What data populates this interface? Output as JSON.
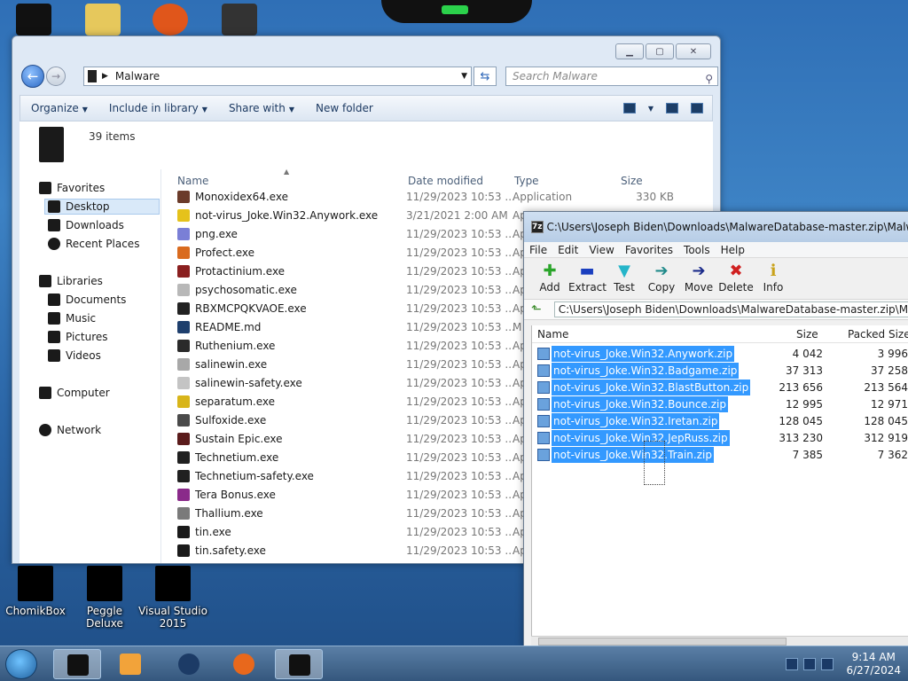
{
  "explorer": {
    "address": "Malware",
    "search_placeholder": "Search Malware",
    "toolbar": {
      "organize": "Organize",
      "include_in_library": "Include in library",
      "share_with": "Share with",
      "new_folder": "New folder"
    },
    "items_count": "39 items",
    "nav": {
      "favorites": "Favorites",
      "desktop": "Desktop",
      "downloads": "Downloads",
      "recent_places": "Recent Places",
      "libraries": "Libraries",
      "documents": "Documents",
      "music": "Music",
      "pictures": "Pictures",
      "videos": "Videos",
      "computer": "Computer",
      "network": "Network"
    },
    "columns": {
      "name": "Name",
      "date": "Date modified",
      "type": "Type",
      "size": "Size"
    },
    "files": [
      {
        "name": "Monoxidex64.exe",
        "date": "11/29/2023 10:53 ...",
        "type": "Application",
        "size": "330 KB",
        "color": "#6b3b2a"
      },
      {
        "name": "not-virus_Joke.Win32.Anywork.exe",
        "date": "3/21/2021 2:00 AM",
        "type": "Ap",
        "size": "",
        "color": "#e5c21b"
      },
      {
        "name": "png.exe",
        "date": "11/29/2023 10:53 ...",
        "type": "Ap",
        "size": "",
        "color": "#7a7fd6"
      },
      {
        "name": "Profect.exe",
        "date": "11/29/2023 10:53 ...",
        "type": "Ap",
        "size": "",
        "color": "#d96b1f"
      },
      {
        "name": "Protactinium.exe",
        "date": "11/29/2023 10:53 ...",
        "type": "Ap",
        "size": "",
        "color": "#8a1f1f"
      },
      {
        "name": "psychosomatic.exe",
        "date": "11/29/2023 10:53 ...",
        "type": "Ap",
        "size": "",
        "color": "#b8b8b8"
      },
      {
        "name": "RBXMCPQKVAOE.exe",
        "date": "11/29/2023 10:53 ...",
        "type": "Ap",
        "size": "",
        "color": "#222222"
      },
      {
        "name": "README.md",
        "date": "11/29/2023 10:53 ...",
        "type": "M",
        "size": "",
        "color": "#1e3f6d"
      },
      {
        "name": "Ruthenium.exe",
        "date": "11/29/2023 10:53 ...",
        "type": "Ap",
        "size": "",
        "color": "#2a2a2a"
      },
      {
        "name": "salinewin.exe",
        "date": "11/29/2023 10:53 ...",
        "type": "Ap",
        "size": "",
        "color": "#a8a8a8"
      },
      {
        "name": "salinewin-safety.exe",
        "date": "11/29/2023 10:53 ...",
        "type": "Ap",
        "size": "",
        "color": "#c4c4c4"
      },
      {
        "name": "separatum.exe",
        "date": "11/29/2023 10:53 ...",
        "type": "Ap",
        "size": "",
        "color": "#d8b51a"
      },
      {
        "name": "Sulfoxide.exe",
        "date": "11/29/2023 10:53 ...",
        "type": "Ap",
        "size": "",
        "color": "#4a4a4a"
      },
      {
        "name": "Sustain Epic.exe",
        "date": "11/29/2023 10:53 ...",
        "type": "Ap",
        "size": "",
        "color": "#5a1b1b"
      },
      {
        "name": "Technetium.exe",
        "date": "11/29/2023 10:53 ...",
        "type": "Ap",
        "size": "",
        "color": "#202020"
      },
      {
        "name": "Technetium-safety.exe",
        "date": "11/29/2023 10:53 ...",
        "type": "Ap",
        "size": "",
        "color": "#202020"
      },
      {
        "name": "Tera Bonus.exe",
        "date": "11/29/2023 10:53 ...",
        "type": "Ap",
        "size": "",
        "color": "#8a2a8a"
      },
      {
        "name": "Thallium.exe",
        "date": "11/29/2023 10:53 ...",
        "type": "Ap",
        "size": "",
        "color": "#7a7a7a"
      },
      {
        "name": "tin.exe",
        "date": "11/29/2023 10:53 ...",
        "type": "Ap",
        "size": "",
        "color": "#1a1a1a"
      },
      {
        "name": "tin.safety.exe",
        "date": "11/29/2023 10:53 ...",
        "type": "Ap",
        "size": "",
        "color": "#1a1a1a"
      }
    ]
  },
  "desktop_icons": [
    {
      "label": "ChomikBox"
    },
    {
      "label": "Peggle Deluxe"
    },
    {
      "label": "Visual Studio 2015"
    }
  ],
  "zip": {
    "title": "C:\\Users\\Joseph Biden\\Downloads\\MalwareDatabase-master.zip\\MalwareDa",
    "menu": [
      "File",
      "Edit",
      "View",
      "Favorites",
      "Tools",
      "Help"
    ],
    "tools": [
      {
        "label": "Add",
        "glyph": "✚",
        "color": "#2aa52a"
      },
      {
        "label": "Extract",
        "glyph": "▬",
        "color": "#1a3fbf"
      },
      {
        "label": "Test",
        "glyph": "▼",
        "color": "#25b5c9"
      },
      {
        "label": "Copy",
        "glyph": "➔",
        "color": "#1f8a8a"
      },
      {
        "label": "Move",
        "glyph": "➔",
        "color": "#1a2a8a"
      },
      {
        "label": "Delete",
        "glyph": "✖",
        "color": "#d02020"
      },
      {
        "label": "Info",
        "glyph": "ℹ",
        "color": "#c9a21a"
      }
    ],
    "path": "C:\\Users\\Joseph Biden\\Downloads\\MalwareDatabase-master.zip\\Malw",
    "columns": {
      "name": "Name",
      "size": "Size",
      "packed": "Packed Size"
    },
    "files": [
      {
        "name": "not-virus_Joke.Win32.Anywork.zip",
        "size": "4 042",
        "packed": "3 996"
      },
      {
        "name": "not-virus_Joke.Win32.Badgame.zip",
        "size": "37 313",
        "packed": "37 258"
      },
      {
        "name": "not-virus_Joke.Win32.BlastButton.zip",
        "size": "213 656",
        "packed": "213 564"
      },
      {
        "name": "not-virus_Joke.Win32.Bounce.zip",
        "size": "12 995",
        "packed": "12 971"
      },
      {
        "name": "not-virus_Joke.Win32.Iretan.zip",
        "size": "128 045",
        "packed": "128 045"
      },
      {
        "name": "not-virus_Joke.Win32.JepRuss.zip",
        "size": "313 230",
        "packed": "312 919"
      },
      {
        "name": "not-virus_Joke.Win32.Train.zip",
        "size": "7 385",
        "packed": "7 362"
      }
    ]
  },
  "taskbar": {
    "time": "9:14 AM",
    "date": "6/27/2024"
  }
}
